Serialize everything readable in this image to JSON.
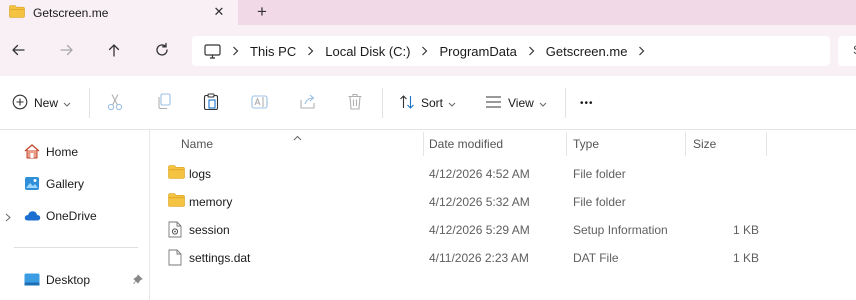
{
  "tab": {
    "title": "Getscreen.me",
    "close_glyph": "✕",
    "new_glyph": "+"
  },
  "nav_buttons": [
    "back-icon",
    "forward-icon",
    "up-icon",
    "refresh-icon"
  ],
  "breadcrumb": {
    "items": [
      "This PC",
      "Local Disk (C:)",
      "ProgramData",
      "Getscreen.me"
    ]
  },
  "search": {
    "visible_fragment": "S"
  },
  "commands": {
    "new_label": "New",
    "sort_label": "Sort",
    "view_label": "View",
    "more_glyph": "•••"
  },
  "nav_pane": {
    "items": [
      {
        "label": "Home",
        "icon": "home-icon"
      },
      {
        "label": "Gallery",
        "icon": "gallery-icon"
      },
      {
        "label": "OneDrive",
        "icon": "onedrive-icon"
      },
      {
        "label": "Desktop",
        "icon": "desktop-icon"
      }
    ]
  },
  "columns": {
    "name": "Name",
    "date": "Date modified",
    "type": "Type",
    "size": "Size"
  },
  "files": [
    {
      "name": "logs",
      "date": "4/12/2026 4:52 AM",
      "type": "File folder",
      "size": "",
      "icon": "folder-icon"
    },
    {
      "name": "memory",
      "date": "4/12/2026 5:32 AM",
      "type": "File folder",
      "size": "",
      "icon": "folder-icon"
    },
    {
      "name": "session",
      "date": "4/12/2026 5:29 AM",
      "type": "Setup Information",
      "size": "1 KB",
      "icon": "settings-file-icon"
    },
    {
      "name": "settings.dat",
      "date": "4/11/2026 2:23 AM",
      "type": "DAT File",
      "size": "1 KB",
      "icon": "file-icon"
    }
  ],
  "colors": {
    "tabstrip": "#f1d9e8",
    "titlebar": "#f8f0f5",
    "folder": "#f5c342",
    "accent": "#1a73c9"
  }
}
